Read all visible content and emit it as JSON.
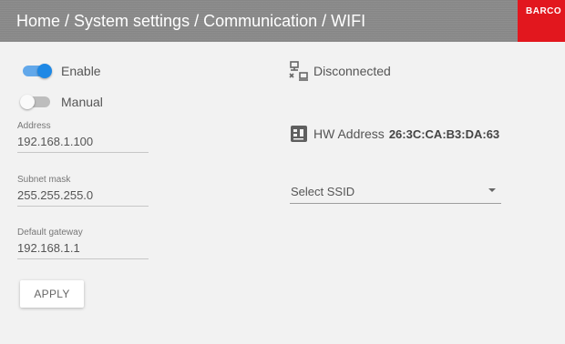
{
  "header": {
    "breadcrumb": "Home / System settings / Communication / WIFI",
    "brand": "BARCO",
    "brand_color": "#e2171e"
  },
  "toggles": {
    "enable": {
      "label": "Enable",
      "on": true
    },
    "manual": {
      "label": "Manual",
      "on": false
    }
  },
  "fields": {
    "address": {
      "label": "Address",
      "value": "192.168.1.100"
    },
    "subnet": {
      "label": "Subnet mask",
      "value": "255.255.255.0"
    },
    "gateway": {
      "label": "Default gateway",
      "value": "192.168.1.1"
    }
  },
  "apply_label": "APPLY",
  "status": {
    "icon": "network-disconnected-icon",
    "text": "Disconnected"
  },
  "hw": {
    "icon": "chip-icon",
    "label": "HW Address",
    "value": "26:3C:CA:B3:DA:63"
  },
  "ssid": {
    "placeholder": "Select SSID"
  },
  "colors": {
    "toggle_on": "#1e88e5",
    "header_bg": "#8a8a8a"
  }
}
